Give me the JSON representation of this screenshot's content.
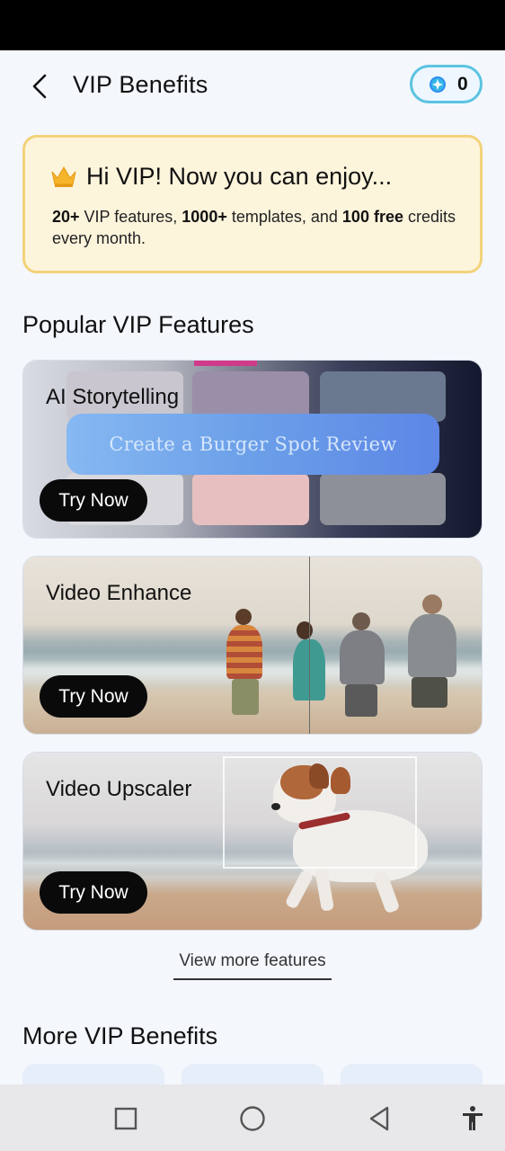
{
  "header": {
    "title": "VIP Benefits",
    "credits": "0",
    "back_icon": "chevron-left-icon",
    "coin_icon": "sparkle-coin-icon"
  },
  "vip_banner": {
    "crown_icon": "crown-icon",
    "heading": "Hi VIP! Now you can enjoy...",
    "desc_part1_bold": "20+",
    "desc_part1": " VIP features, ",
    "desc_part2_bold": "1000+",
    "desc_part2": " templates, and ",
    "desc_part3_bold": "100 free",
    "desc_part3": " credits every month."
  },
  "popular": {
    "title": "Popular VIP Features",
    "cards": [
      {
        "label": "AI Storytelling",
        "button": "Try Now",
        "prompt": "Create a Burger Spot Review"
      },
      {
        "label": "Video Enhance",
        "button": "Try Now"
      },
      {
        "label": "Video Upscaler",
        "button": "Try Now"
      }
    ],
    "view_more": "View more features"
  },
  "more_benefits": {
    "title": "More VIP Benefits"
  },
  "nav": {
    "recents_icon": "square-recents-icon",
    "home_icon": "circle-home-icon",
    "back_icon": "triangle-back-icon",
    "accessibility_icon": "accessibility-icon"
  },
  "colors": {
    "banner_bg": "#fdf4dc",
    "banner_border": "#f3d27a",
    "pill_border": "#5bc4e0",
    "button_bg": "#0a0a0a"
  }
}
